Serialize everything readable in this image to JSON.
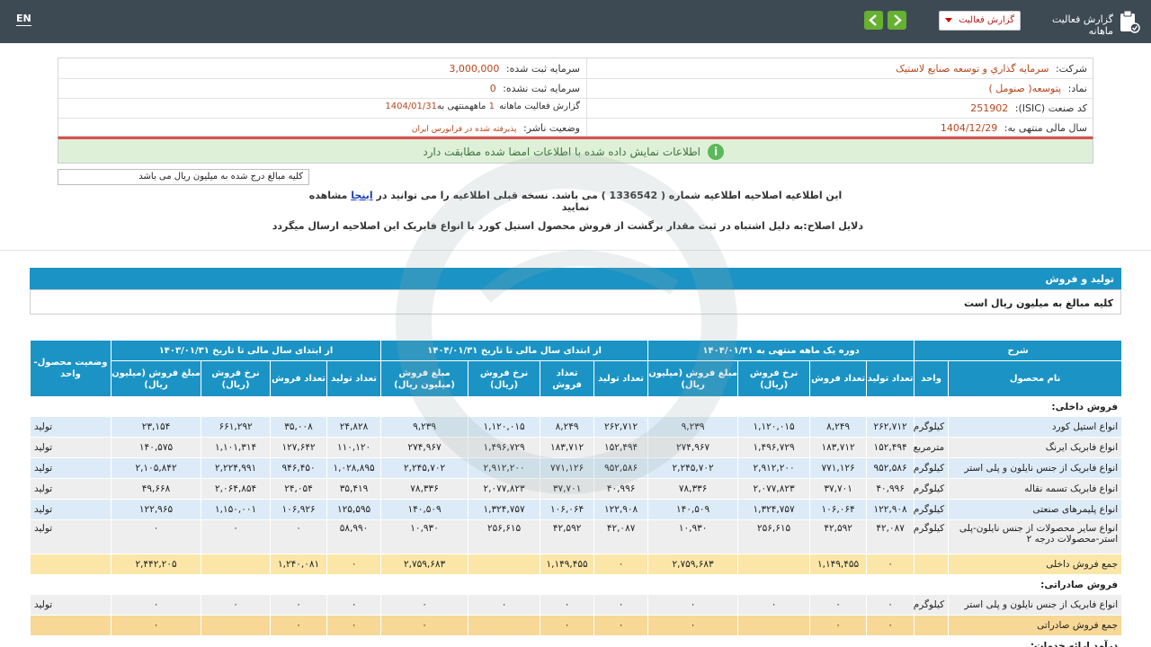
{
  "topbar": {
    "lang": "EN",
    "title": "گزارش فعالیت ماهانه",
    "select_value": "گزارش فعالیت",
    "colors": {
      "bar": "#3d4a54",
      "nav": "#66b032"
    }
  },
  "info": {
    "company_label": "شرکت:",
    "company_value": "سرمايه گذاري و توسعه صنايع لاستيک",
    "symbol_label": "نماد:",
    "symbol_value": "پتوسعه( صنومل )",
    "isic_label": "کد صنعت (ISIC):",
    "isic_value": "251902",
    "fiscal_label": "سال مالی منتهی به:",
    "fiscal_value": "1404/12/29",
    "reg_capital_label": "سرمایه ثبت شده:",
    "reg_capital_value": "3,000,000",
    "unreg_capital_label": "سرمایه ثبت نشده:",
    "unreg_capital_value": "0",
    "report_label_a": "گزارش فعالیت ماهانه",
    "report_months": "1",
    "report_label_b": "ماهه",
    "report_label_c": "منتهی به",
    "report_date": "1404/01/31",
    "status_label": "وضعیت ناشر:",
    "status_value": "پذیرفته شده در فرابورس ایران"
  },
  "alert": {
    "text": "اطلاعات نمایش داده شده با اطلاعات امضا شده مطابقت دارد",
    "icon": "info-icon"
  },
  "amount_note": "کلیه مبالغ درج شده به میلیون ریال می باشد",
  "notice": {
    "line1_a": "این اطلاعیه اصلاحیه اطلاعیه شماره ( 1336542 ) می باشد. نسخه قبلی اطلاعیه را می توانید در",
    "line1_link": "اینجا",
    "line1_b": "مشاهده نمایید",
    "line2": "دلایل اصلاح:به دلیل اشتباه در ثبت مقدار برگشت از فروش محصول استیل کورد با انواع فابریک این اصلاحیه ارسال میگردد"
  },
  "section": {
    "title": "تولید و فروش",
    "subtitle": "کلیه مبالغ به میلیون ریال است"
  },
  "table": {
    "group_headers": {
      "desc": "شرح",
      "period": "دوره یک ماهه منتهی به ۱۴۰۴/۰۱/۳۱",
      "ytd": "از ابتدای سال مالی تا تاریخ ۱۴۰۴/۰۱/۳۱",
      "prev": "از ابتدای سال مالی تا تاریخ ۱۴۰۳/۰۱/۳۱",
      "status": "وضعیت محصول-واحد"
    },
    "sub_headers": {
      "name": "نام محصول",
      "unit": "واحد",
      "prod_qty": "تعداد تولید",
      "sale_qty": "تعداد فروش",
      "rate": "نرخ فروش (ریال)",
      "amount": "مبلغ فروش (میلیون ریال)"
    },
    "domestic_title": "فروش داخلی:",
    "domestic_rows": [
      {
        "name": "انواع استیل کورد",
        "unit": "کیلوگرم",
        "p_prod": "۲۶۲,۷۱۲",
        "p_sale": "۸,۲۴۹",
        "p_rate": "۱,۱۲۰,۰۱۵",
        "p_amt": "۹,۲۳۹",
        "y_prod": "۲۶۲,۷۱۲",
        "y_sale": "۸,۲۴۹",
        "y_rate": "۱,۱۲۰,۰۱۵",
        "y_amt": "۹,۲۳۹",
        "v_prod": "۲۴,۸۲۸",
        "v_sale": "۳۵,۰۰۸",
        "v_rate": "۶۶۱,۲۹۲",
        "v_amt": "۲۳,۱۵۴",
        "status": "تولید"
      },
      {
        "name": "انواع فابریک ایرنگ",
        "unit": "مترمربع",
        "p_prod": "۱۵۲,۴۹۴",
        "p_sale": "۱۸۳,۷۱۲",
        "p_rate": "۱,۴۹۶,۷۲۹",
        "p_amt": "۲۷۴,۹۶۷",
        "y_prod": "۱۵۲,۴۹۴",
        "y_sale": "۱۸۳,۷۱۲",
        "y_rate": "۱,۴۹۶,۷۲۹",
        "y_amt": "۲۷۴,۹۶۷",
        "v_prod": "۱۱۰,۱۲۰",
        "v_sale": "۱۲۷,۶۴۲",
        "v_rate": "۱,۱۰۱,۳۱۴",
        "v_amt": "۱۴۰,۵۷۵",
        "status": "تولید"
      },
      {
        "name": "انواع فابریک از جنس نایلون و پلی استر",
        "unit": "کیلوگرم",
        "p_prod": "۹۵۲,۵۸۶",
        "p_sale": "۷۷۱,۱۲۶",
        "p_rate": "۲,۹۱۲,۲۰۰",
        "p_amt": "۲,۲۴۵,۷۰۲",
        "y_prod": "۹۵۲,۵۸۶",
        "y_sale": "۷۷۱,۱۲۶",
        "y_rate": "۲,۹۱۲,۲۰۰",
        "y_amt": "۲,۲۴۵,۷۰۲",
        "v_prod": "۱,۰۲۸,۸۹۵",
        "v_sale": "۹۴۶,۴۵۰",
        "v_rate": "۲,۲۲۴,۹۹۱",
        "v_amt": "۲,۱۰۵,۸۴۲",
        "status": "تولید"
      },
      {
        "name": "انواع فابریک تسمه نقاله",
        "unit": "کیلوگرم",
        "p_prod": "۴۰,۹۹۶",
        "p_sale": "۳۷,۷۰۱",
        "p_rate": "۲,۰۷۷,۸۲۳",
        "p_amt": "۷۸,۳۳۶",
        "y_prod": "۴۰,۹۹۶",
        "y_sale": "۳۷,۷۰۱",
        "y_rate": "۲,۰۷۷,۸۲۳",
        "y_amt": "۷۸,۳۳۶",
        "v_prod": "۳۵,۴۱۹",
        "v_sale": "۲۴,۰۵۴",
        "v_rate": "۲,۰۶۴,۸۵۴",
        "v_amt": "۴۹,۶۶۸",
        "status": "تولید"
      },
      {
        "name": "انواع پلیمرهای صنعتی",
        "unit": "کیلوگرم",
        "p_prod": "۱۲۲,۹۰۸",
        "p_sale": "۱۰۶,۰۶۴",
        "p_rate": "۱,۳۲۴,۷۵۷",
        "p_amt": "۱۴۰,۵۰۹",
        "y_prod": "۱۲۲,۹۰۸",
        "y_sale": "۱۰۶,۰۶۴",
        "y_rate": "۱,۳۲۴,۷۵۷",
        "y_amt": "۱۴۰,۵۰۹",
        "v_prod": "۱۲۵,۵۹۵",
        "v_sale": "۱۰۶,۹۲۶",
        "v_rate": "۱,۱۵۰,۰۰۱",
        "v_amt": "۱۲۲,۹۶۵",
        "status": "تولید"
      },
      {
        "name": "انواع سایر محصولات از جنس نایلون-پلی استر-محصولات درجه ۲",
        "unit": "کیلوگرم",
        "p_prod": "۴۲,۰۸۷",
        "p_sale": "۴۲,۵۹۲",
        "p_rate": "۲۵۶,۶۱۵",
        "p_amt": "۱۰,۹۳۰",
        "y_prod": "۴۲,۰۸۷",
        "y_sale": "۴۲,۵۹۲",
        "y_rate": "۲۵۶,۶۱۵",
        "y_amt": "۱۰,۹۳۰",
        "v_prod": "۵۸,۹۹۰",
        "v_sale": "۰",
        "v_rate": "۰",
        "v_amt": "۰",
        "status": "تولید"
      }
    ],
    "domestic_total": {
      "name": "جمع فروش داخلی",
      "p_prod": "۰",
      "p_sale": "۱,۱۴۹,۴۵۵",
      "p_rate": "",
      "p_amt": "۲,۷۵۹,۶۸۳",
      "y_prod": "۰",
      "y_sale": "۱,۱۴۹,۴۵۵",
      "y_rate": "",
      "y_amt": "۲,۷۵۹,۶۸۳",
      "v_prod": "۰",
      "v_sale": "۱,۲۴۰,۰۸۱",
      "v_rate": "",
      "v_amt": "۲,۴۴۲,۲۰۵"
    },
    "export_title": "فروش صادراتی:",
    "export_rows": [
      {
        "name": "انواع فابریک از جنس نایلون و پلی استر",
        "unit": "کیلوگرم",
        "p_prod": "۰",
        "p_sale": "۰",
        "p_rate": "۰",
        "p_amt": "۰",
        "y_prod": "۰",
        "y_sale": "۰",
        "y_rate": "۰",
        "y_amt": "۰",
        "v_prod": "۰",
        "v_sale": "۰",
        "v_rate": "۰",
        "v_amt": "۰",
        "status": "تولید"
      }
    ],
    "export_total": {
      "name": "جمع فروش صادراتی",
      "p_prod": "۰",
      "p_sale": "۰",
      "p_rate": "",
      "p_amt": "۰",
      "y_prod": "۰",
      "y_sale": "۰",
      "y_rate": "",
      "y_amt": "۰",
      "v_prod": "۰",
      "v_sale": "۰",
      "v_rate": "",
      "v_amt": "۰"
    },
    "services_title": "درآمد ارائه خدمات:"
  }
}
